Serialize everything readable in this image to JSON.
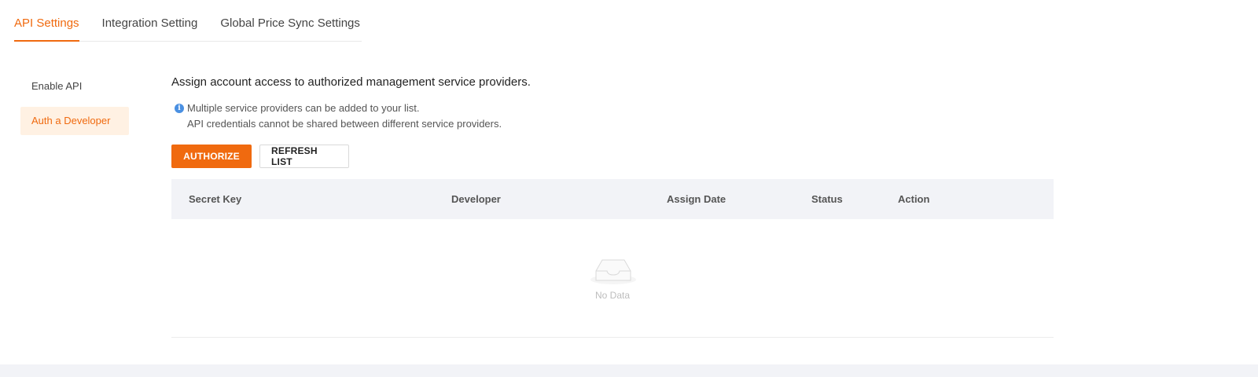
{
  "tabs": [
    {
      "label": "API Settings",
      "active": true
    },
    {
      "label": "Integration Setting",
      "active": false
    },
    {
      "label": "Global Price Sync Settings",
      "active": false
    }
  ],
  "side_menu": [
    {
      "label": "Enable API",
      "active": false
    },
    {
      "label": "Auth a Developer",
      "active": true
    }
  ],
  "content": {
    "headline": "Assign account access to authorized management service providers.",
    "notice": {
      "icon": "info-icon",
      "lines": [
        "Multiple service providers can be added to your list.",
        "API credentials cannot be shared between different service providers."
      ]
    },
    "buttons": {
      "authorize": "AUTHORIZE",
      "refresh": "REFRESH LIST"
    },
    "table": {
      "columns": [
        "Secret Key",
        "Developer",
        "Assign Date",
        "Status",
        "Action"
      ],
      "rows": [],
      "empty_text": "No Data",
      "empty_icon": "empty-inbox-icon"
    }
  },
  "colors": {
    "accent": "#f06a0f",
    "accent_light_bg": "#fff1e3",
    "table_header_bg": "#f2f3f7",
    "info_icon": "#4a90e2"
  }
}
